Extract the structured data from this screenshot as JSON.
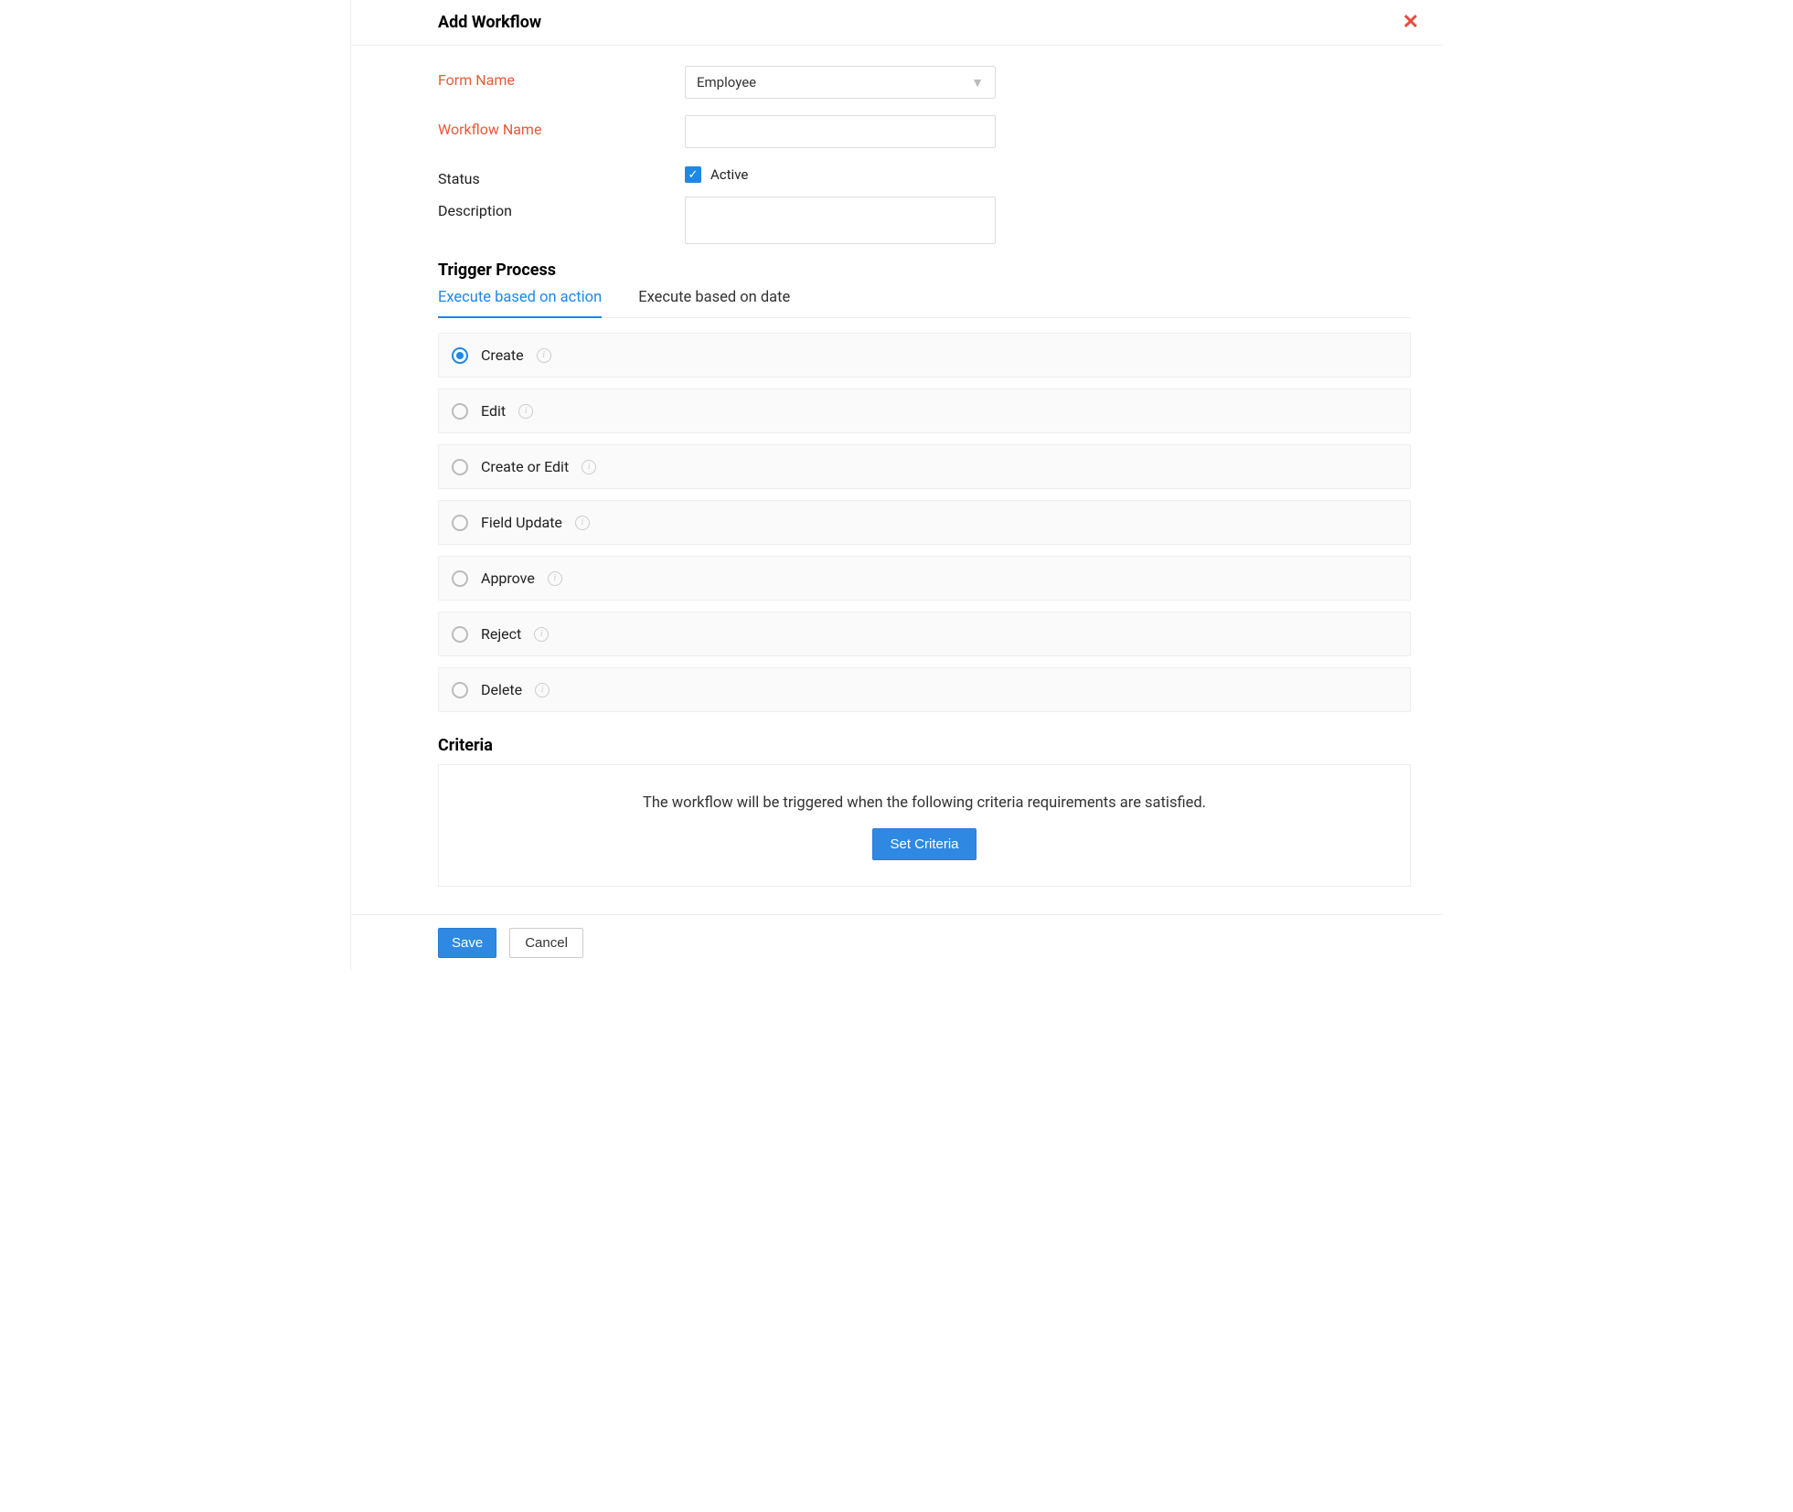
{
  "header": {
    "title": "Add Workflow"
  },
  "form": {
    "form_name_label": "Form Name",
    "form_name_value": "Employee",
    "workflow_name_label": "Workflow Name",
    "workflow_name_value": "",
    "status_label": "Status",
    "status_checked": true,
    "status_checkbox_label": "Active",
    "description_label": "Description",
    "description_value": ""
  },
  "trigger": {
    "title": "Trigger Process",
    "tabs": [
      {
        "label": "Execute based on action",
        "active": true
      },
      {
        "label": "Execute based on date",
        "active": false
      }
    ],
    "options": [
      {
        "label": "Create",
        "selected": true
      },
      {
        "label": "Edit",
        "selected": false
      },
      {
        "label": "Create or Edit",
        "selected": false
      },
      {
        "label": "Field Update",
        "selected": false
      },
      {
        "label": "Approve",
        "selected": false
      },
      {
        "label": "Reject",
        "selected": false
      },
      {
        "label": "Delete",
        "selected": false
      }
    ]
  },
  "criteria": {
    "title": "Criteria",
    "message": "The workflow will be triggered when the following criteria requirements are satisfied.",
    "button": "Set Criteria"
  },
  "footer": {
    "save": "Save",
    "cancel": "Cancel"
  }
}
